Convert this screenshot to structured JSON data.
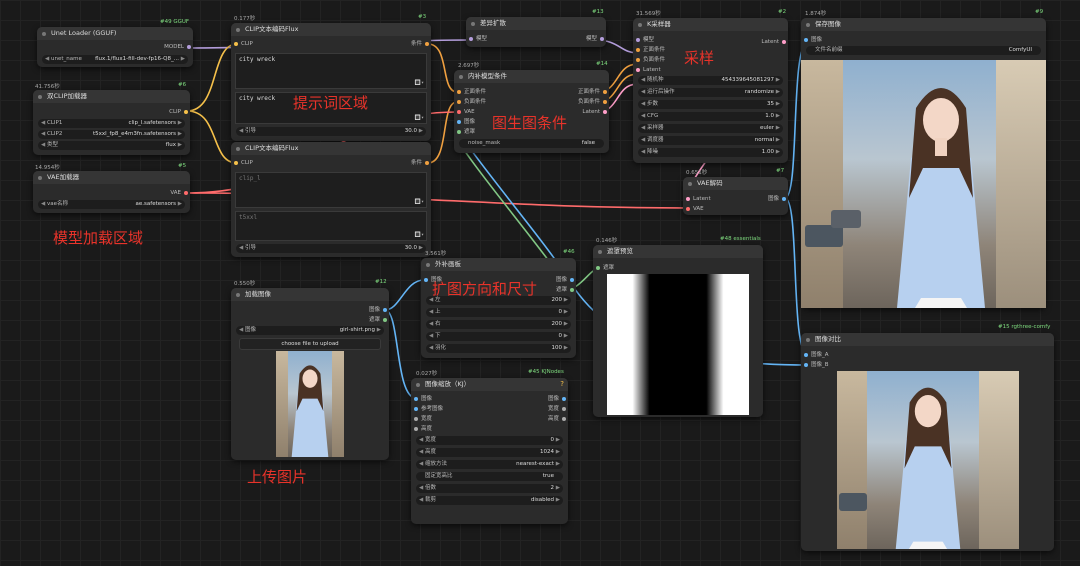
{
  "nodes": {
    "unet": {
      "id": "#49 GGUF",
      "title": "Unet Loader (GGUF)",
      "out": "MODEL",
      "w_label": "unet_name",
      "w_val": "flux.1/flux1-fill-dev-fp16-Q8_..."
    },
    "dualclip": {
      "time": "41.756秒",
      "id": "#6",
      "title": "双CLIP加载器",
      "out": "CLIP",
      "w": [
        {
          "label": "CLIP1",
          "val": "clip_l.safetensors"
        },
        {
          "label": "CLIP2",
          "val": "t5xxl_fp8_e4m3fn.safetensors"
        },
        {
          "label": "类型",
          "val": "flux"
        }
      ]
    },
    "vae": {
      "time": "14.954秒",
      "id": "#5",
      "title": "VAE加载器",
      "out": "VAE",
      "w_label": "vae名称",
      "w_val": "ae.safetensors"
    },
    "clip1": {
      "time": "0.177秒",
      "id": "#3",
      "title": "CLIP文本编码Flux",
      "in": "CLIP",
      "out": "条件",
      "t1": "city wreck",
      "t2": "city wreck",
      "g_label": "引导",
      "g_val": "30.0"
    },
    "clip2": {
      "title": "CLIP文本编码Flux",
      "in": "CLIP",
      "out": "条件",
      "t1": "clip_l",
      "t2": "t5xxl",
      "g_label": "引导",
      "g_val": "30.0"
    },
    "diff": {
      "id": "#13",
      "title": "差异扩散",
      "in": "模型",
      "out": "模型"
    },
    "inpaint": {
      "time": "2.697秒",
      "id": "#14",
      "title": "内补模型条件",
      "ins": [
        "正面条件",
        "负面条件",
        "VAE",
        "图像",
        "遮罩"
      ],
      "outs": [
        "正面条件",
        "负面条件",
        "Latent"
      ],
      "w_label": "noise_mask",
      "w_val": "false"
    },
    "ksampler": {
      "time": "31.569秒",
      "id": "#2",
      "title": "K采样器",
      "ins": [
        "模型",
        "正面条件",
        "负面条件",
        "Latent"
      ],
      "out": "Latent",
      "w": [
        {
          "label": "随机种",
          "val": "454339645081297"
        },
        {
          "label": "运行后操作",
          "val": "randomize"
        },
        {
          "label": "步数",
          "val": "35"
        },
        {
          "label": "CFG",
          "val": "1.0"
        },
        {
          "label": "采样器",
          "val": "euler"
        },
        {
          "label": "调度器",
          "val": "normal"
        },
        {
          "label": "降噪",
          "val": "1.00"
        }
      ]
    },
    "vaedec": {
      "time": "0.651秒",
      "id": "#7",
      "title": "VAE解码",
      "ins": [
        "Latent",
        "VAE"
      ],
      "out": "图像"
    },
    "save": {
      "time": "1.874秒",
      "id": "#9",
      "title": "保存图像",
      "in": "图像",
      "w_label": "文件名前缀",
      "w_val": "ComfyUI"
    },
    "pad": {
      "time": "3.561秒",
      "title": "外补画板",
      "in": "图像",
      "outs": [
        "图像",
        "遮罩"
      ],
      "w": [
        {
          "label": "左",
          "val": "200"
        },
        {
          "label": "上",
          "val": "0"
        },
        {
          "label": "右",
          "val": "200"
        },
        {
          "label": "下",
          "val": "0"
        },
        {
          "label": "羽化",
          "val": "100"
        }
      ]
    },
    "mask": {
      "time": "0.146秒",
      "id": "#48 essentials",
      "title": "遮罩预览",
      "in": "遮罩"
    },
    "load": {
      "time": "0.550秒",
      "id": "#12",
      "title": "加载图像",
      "outs": [
        "图像",
        "遮罩"
      ],
      "w_label": "图像",
      "w_val": "girl-shirt.png",
      "btn": "choose file to upload"
    },
    "resize": {
      "time": "0.027秒",
      "id": "#45 KJNodes",
      "title": "图像缩放（KJ）",
      "ins": [
        "图像",
        "参考图像",
        "宽度",
        "高度"
      ],
      "outs": [
        "图像",
        "宽度",
        "高度"
      ],
      "w": [
        {
          "label": "宽度",
          "val": "0"
        },
        {
          "label": "高度",
          "val": "1024"
        },
        {
          "label": "缩放方法",
          "val": "nearest-exact"
        },
        {
          "label": "固定宽高比",
          "val": "true"
        },
        {
          "label": "倍数",
          "val": "2"
        },
        {
          "label": "裁剪",
          "val": "disabled"
        }
      ],
      "badge": "?"
    },
    "compare": {
      "id": "#15 rgthree-comfy",
      "title": "图像对比",
      "ins": [
        "图像_A",
        "图像_B"
      ]
    },
    "edge46": "#46"
  },
  "notes": {
    "prompt": "提示词区域",
    "img2img": "图生图条件",
    "sampling": "采样",
    "model": "模型加载区域",
    "pad": "扩图方向和尺寸",
    "upload": "上传图片"
  },
  "colors": {
    "clip": "#f5c04a",
    "model": "#b39ddb",
    "cond": "#f0a040",
    "vae": "#ff6b6b",
    "image": "#64b5f6",
    "mask": "#81c784",
    "latent": "#ff9ec8"
  }
}
